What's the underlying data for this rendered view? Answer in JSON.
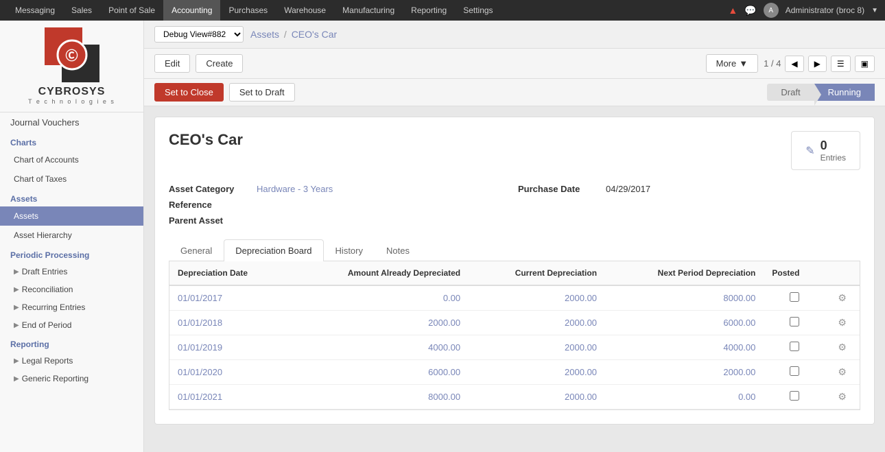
{
  "topNav": {
    "items": [
      {
        "label": "Messaging",
        "active": false
      },
      {
        "label": "Sales",
        "active": false
      },
      {
        "label": "Point of Sale",
        "active": false
      },
      {
        "label": "Accounting",
        "active": true
      },
      {
        "label": "Purchases",
        "active": false
      },
      {
        "label": "Warehouse",
        "active": false
      },
      {
        "label": "Manufacturing",
        "active": false
      },
      {
        "label": "Reporting",
        "active": false
      },
      {
        "label": "Settings",
        "active": false
      }
    ],
    "user": "Administrator (broc  8)",
    "userInitial": "A"
  },
  "debugSelect": "Debug View#882",
  "breadcrumb": {
    "parent": "Assets",
    "separator": "/",
    "current": "CEO's Car"
  },
  "toolbar": {
    "editLabel": "Edit",
    "createLabel": "Create",
    "moreLabel": "More",
    "pageInfo": "1 / 4"
  },
  "statusSteps": [
    {
      "label": "Draft",
      "active": false
    },
    {
      "label": "Running",
      "active": true
    }
  ],
  "buttons": {
    "setToClose": "Set to Close",
    "setToDraft": "Set to Draft"
  },
  "asset": {
    "title": "CEO's Car",
    "entries": {
      "count": "0",
      "label": "Entries"
    },
    "fields": {
      "assetCategory": "Asset Category",
      "assetCategoryValue": "Hardware - 3 Years",
      "reference": "Reference",
      "referenceValue": "",
      "parentAsset": "Parent Asset",
      "parentAssetValue": "",
      "purchaseDate": "Purchase Date",
      "purchaseDateValue": "04/29/2017"
    }
  },
  "tabs": [
    {
      "label": "General",
      "active": false
    },
    {
      "label": "Depreciation Board",
      "active": true
    },
    {
      "label": "History",
      "active": false
    },
    {
      "label": "Notes",
      "active": false
    }
  ],
  "table": {
    "columns": [
      {
        "label": "Depreciation Date",
        "key": "date"
      },
      {
        "label": "Amount Already Depreciated",
        "key": "amountAlready",
        "number": true
      },
      {
        "label": "Current Depreciation",
        "key": "currentDep",
        "number": true
      },
      {
        "label": "Next Period Depreciation",
        "key": "nextPeriod",
        "number": true
      },
      {
        "label": "Posted",
        "key": "posted"
      }
    ],
    "rows": [
      {
        "date": "01/01/2017",
        "amountAlready": "0.00",
        "currentDep": "2000.00",
        "nextPeriod": "8000.00",
        "posted": false
      },
      {
        "date": "01/01/2018",
        "amountAlready": "2000.00",
        "currentDep": "2000.00",
        "nextPeriod": "6000.00",
        "posted": false
      },
      {
        "date": "01/01/2019",
        "amountAlready": "4000.00",
        "currentDep": "2000.00",
        "nextPeriod": "4000.00",
        "posted": false
      },
      {
        "date": "01/01/2020",
        "amountAlready": "6000.00",
        "currentDep": "2000.00",
        "nextPeriod": "2000.00",
        "posted": false
      },
      {
        "date": "01/01/2021",
        "amountAlready": "8000.00",
        "currentDep": "2000.00",
        "nextPeriod": "0.00",
        "posted": false
      }
    ]
  },
  "sidebar": {
    "journalVouchers": "Journal Vouchers",
    "chartsSection": "Charts",
    "chartOfAccounts": "Chart of Accounts",
    "chartOfTaxes": "Chart of Taxes",
    "assetsSection": "Assets",
    "assets": "Assets",
    "assetHierarchy": "Asset Hierarchy",
    "periodicSection": "Periodic Processing",
    "draftEntries": "Draft Entries",
    "reconciliation": "Reconciliation",
    "recurringEntries": "Recurring Entries",
    "endOfPeriod": "End of Period",
    "reportingSection": "Reporting",
    "legalReports": "Legal Reports",
    "genericReporting": "Generic Reporting"
  }
}
